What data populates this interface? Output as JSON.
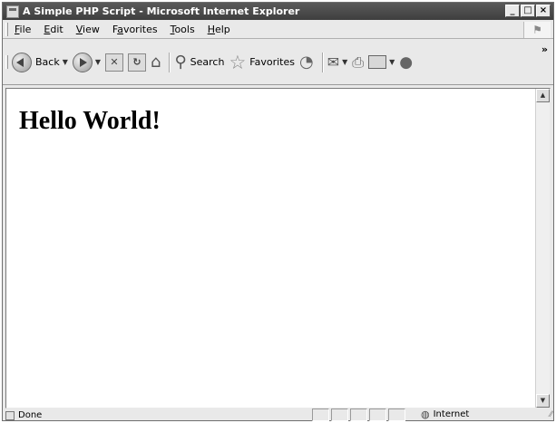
{
  "window": {
    "title": "A Simple PHP Script - Microsoft Internet Explorer",
    "controls": {
      "minimize": "_",
      "maximize": "□",
      "close": "×"
    }
  },
  "menu": {
    "items": [
      {
        "prefix": "",
        "accel": "F",
        "rest": "ile"
      },
      {
        "prefix": "",
        "accel": "E",
        "rest": "dit"
      },
      {
        "prefix": "",
        "accel": "V",
        "rest": "iew"
      },
      {
        "prefix": "F",
        "accel": "a",
        "rest": "vorites"
      },
      {
        "prefix": "",
        "accel": "T",
        "rest": "ools"
      },
      {
        "prefix": "",
        "accel": "H",
        "rest": "elp"
      }
    ]
  },
  "toolbar": {
    "back": "Back",
    "search": "Search",
    "favorites": "Favorites",
    "overflow": "»"
  },
  "page": {
    "heading": "Hello World!"
  },
  "status": {
    "text": "Done",
    "zone": "Internet"
  },
  "icons": {
    "back": "back-arrow-icon",
    "forward": "forward-arrow-icon",
    "stop": "stop-icon",
    "refresh": "refresh-icon",
    "home": "home-icon",
    "search": "search-icon",
    "favorites": "star-icon",
    "history": "history-icon",
    "mail": "mail-icon",
    "print": "printer-icon",
    "edit": "edit-icon",
    "discuss": "discuss-icon",
    "internet": "globe-icon"
  },
  "colors": {
    "titlebar": "#4a4a4a",
    "chrome": "#e9e9e9",
    "content": "#ffffff"
  }
}
